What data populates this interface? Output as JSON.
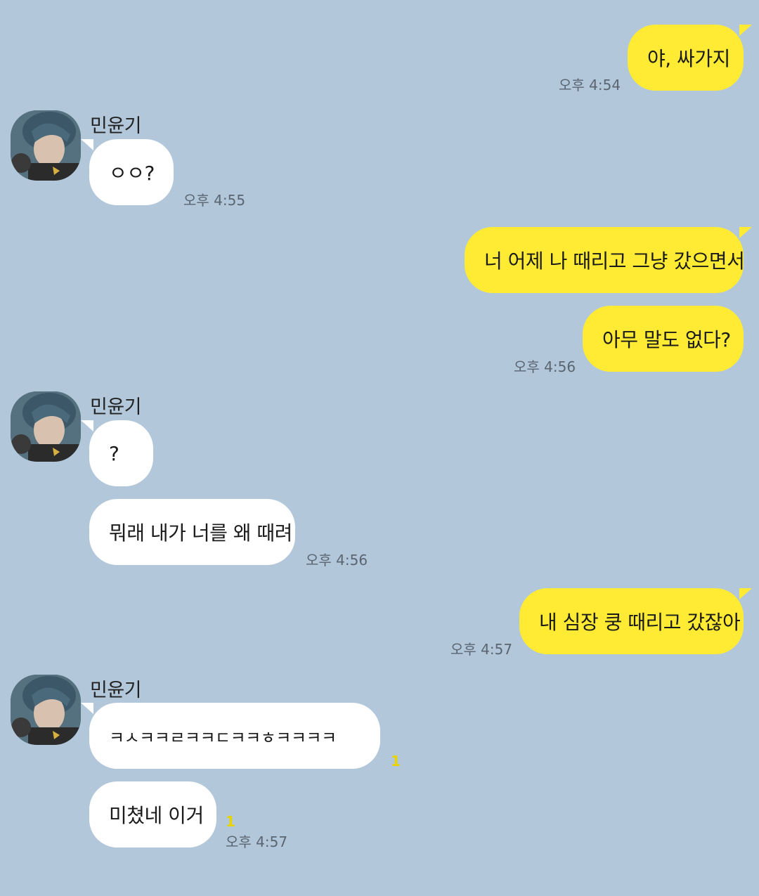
{
  "contact": {
    "name": "민윤기"
  },
  "messages": [
    {
      "text": "야, 싸가지",
      "time": "오후 4:54"
    },
    {
      "text": "ㅇㅇ?",
      "time": "오후 4:55"
    },
    {
      "text": "너 어제 나 때리고 그냥 갔으면서"
    },
    {
      "text": "아무 말도 없다?",
      "time": "오후 4:56"
    },
    {
      "text": "?"
    },
    {
      "text": "뭐래 내가 너를 왜 때려",
      "time": "오후 4:56"
    },
    {
      "text": "내 심장 쿵 때리고 갔잖아",
      "time": "오후 4:57"
    },
    {
      "text": "ㅋㅅㅋㅋㄹㅋㅋㄷㅋㅋㅎㅋㅋㅋㅋ",
      "unread": "1"
    },
    {
      "text": "미쳤네 이거",
      "unread": "1",
      "time": "오후 4:57"
    }
  ],
  "icons": {
    "avatar": "profile-photo"
  },
  "colors": {
    "background": "#b2c7da",
    "my_bubble": "#ffeb33",
    "their_bubble": "#ffffff",
    "unread": "#e8d300"
  }
}
